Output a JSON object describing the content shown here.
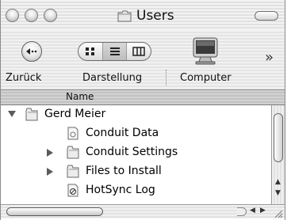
{
  "window": {
    "title": "Users"
  },
  "toolbar": {
    "back_label": "Zurück",
    "view_label": "Darstellung",
    "computer_label": "Computer",
    "overflow_glyph": "»"
  },
  "list_header": {
    "name_column": "Name"
  },
  "items": [
    {
      "label": "Gerd Meier",
      "kind": "folder",
      "disclosure": "expanded"
    },
    {
      "label": "Conduit Data",
      "kind": "document",
      "disclosure": "none"
    },
    {
      "label": "Conduit Settings",
      "kind": "folder",
      "disclosure": "collapsed"
    },
    {
      "label": "Files to Install",
      "kind": "folder",
      "disclosure": "collapsed"
    },
    {
      "label": "HotSync Log",
      "kind": "log-file",
      "disclosure": "none"
    }
  ],
  "colors": {
    "window_bg": "#ffffff",
    "stripe_light": "#f3f3f3",
    "stripe_dark": "#e1e1e1"
  }
}
